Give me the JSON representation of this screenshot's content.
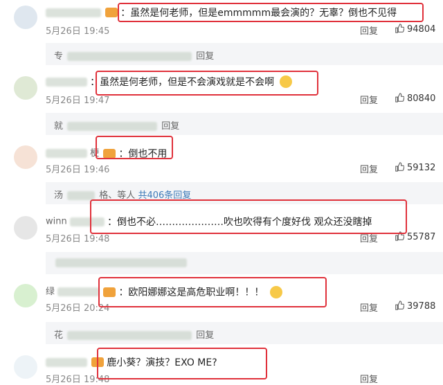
{
  "comments": [
    {
      "id": "c1",
      "user_visible": "",
      "text": "：虽然是何老师，但是emmmmm最会演的？无辜？倒也不见得",
      "date": "5月26日 19:45",
      "reply_label": "回复",
      "likes": "94804",
      "subreply_prefix": "专",
      "subreply_suffix": "回复"
    },
    {
      "id": "c2",
      "user_visible": "",
      "text": "：虽然是何老师，但是不会演戏就是不会啊",
      "date": "5月26日 19:47",
      "reply_label": "回复",
      "likes": "80840",
      "subreply_prefix": "就",
      "subreply_suffix": "回复"
    },
    {
      "id": "c3",
      "user_visible": "梗",
      "text": "：倒也不用",
      "date": "5月26日 19:46",
      "reply_label": "回复",
      "likes": "59132",
      "subreply_prefix": "汤",
      "subreply_mid": "格、等人",
      "subreply_count": "共406条回复"
    },
    {
      "id": "c4",
      "user_visible": "winn",
      "text": "：倒也不必…………………吹也吹得有个度好伐 观众还没瞎掉",
      "date": "5月26日 19:48",
      "reply_label": "回复",
      "likes": "55787",
      "subreply_prefix": "",
      "subreply_suffix": ""
    },
    {
      "id": "c5",
      "user_visible": "绿",
      "text": "：欧阳娜娜这是高危职业啊！！！",
      "date": "5月26日 20:24",
      "reply_label": "回复",
      "likes": "39788",
      "subreply_prefix": "花",
      "subreply_suffix": "回复"
    },
    {
      "id": "c6",
      "user_visible": "",
      "text": "鹿小葵？演技？EXO ME?",
      "date": "5月26日 19:48",
      "reply_label": "回复",
      "likes": ""
    }
  ],
  "colors": {
    "highlight": "#e0303a",
    "link": "#3d7ab8",
    "subreply_bg": "#f4f5f7"
  },
  "icons": {
    "like": "thumbs-up-icon",
    "badge": "crown-badge-icon",
    "emoji": "smiley-emoji-icon"
  }
}
